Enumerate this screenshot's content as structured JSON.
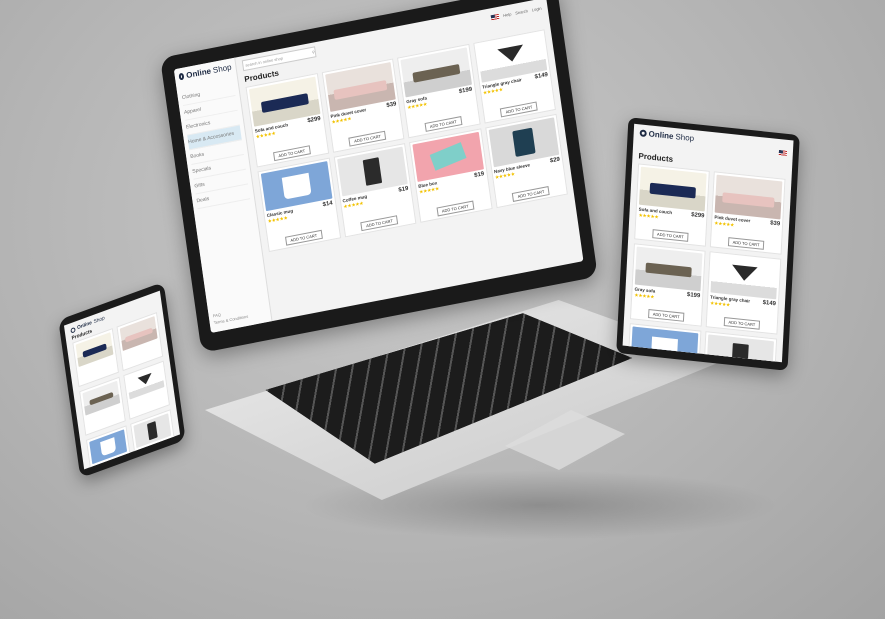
{
  "shop": {
    "brand_bold": "Online",
    "brand_light": "Shop",
    "search_placeholder": "search in online shop",
    "page_title": "Products",
    "add_to_cart": "ADD TO CART",
    "sidebar": [
      "Clothing",
      "Apparel",
      "Electronics",
      "Home & Accessories",
      "Books",
      "Specials",
      "Gifts",
      "Deals"
    ],
    "footer_links": [
      "FAQ",
      "Terms & Conditions"
    ],
    "top_links": [
      "Help",
      "Search",
      "Login"
    ],
    "products": [
      {
        "name": "Sofa and couch",
        "price": "$299",
        "bg": "sofa"
      },
      {
        "name": "Pink duvet cover",
        "price": "$39",
        "bg": "bed"
      },
      {
        "name": "Gray sofa",
        "price": "$199",
        "bg": "gray-sofa"
      },
      {
        "name": "Triangle gray chair",
        "price": "$149",
        "bg": "chair"
      },
      {
        "name": "Classic mug",
        "price": "$14",
        "bg": "mug"
      },
      {
        "name": "Coffee mug",
        "price": "$19",
        "bg": "coffee"
      },
      {
        "name": "Blue box",
        "price": "$19",
        "bg": "box"
      },
      {
        "name": "Navy blue sleeve",
        "price": "$29",
        "bg": "sleeve"
      }
    ]
  }
}
